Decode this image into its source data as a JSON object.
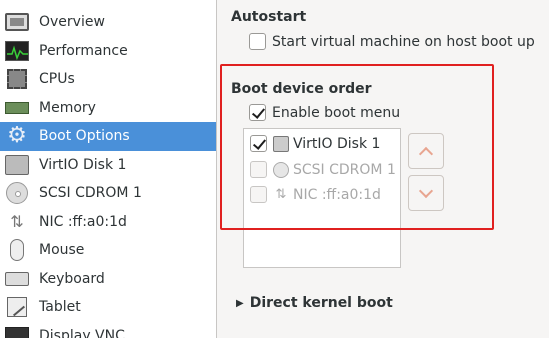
{
  "sidebar": {
    "items": [
      {
        "label": "Overview",
        "icon": "overview-icon"
      },
      {
        "label": "Performance",
        "icon": "performance-icon"
      },
      {
        "label": "CPUs",
        "icon": "cpu-icon"
      },
      {
        "label": "Memory",
        "icon": "memory-icon"
      },
      {
        "label": "Boot Options",
        "icon": "gear-icon",
        "selected": true
      },
      {
        "label": "VirtIO Disk 1",
        "icon": "disk-icon"
      },
      {
        "label": "SCSI CDROM 1",
        "icon": "cdrom-icon"
      },
      {
        "label": "NIC :ff:a0:1d",
        "icon": "network-icon"
      },
      {
        "label": "Mouse",
        "icon": "mouse-icon"
      },
      {
        "label": "Keyboard",
        "icon": "keyboard-icon"
      },
      {
        "label": "Tablet",
        "icon": "tablet-icon"
      },
      {
        "label": "Display VNC",
        "icon": "display-icon"
      }
    ]
  },
  "autostart": {
    "heading": "Autostart",
    "checkbox_label": "Start virtual machine on host boot up",
    "checked": false
  },
  "boot": {
    "heading": "Boot device order",
    "enable_menu_label": "Enable boot menu",
    "enable_menu_checked": true,
    "devices": [
      {
        "label": "VirtIO Disk 1",
        "checked": true,
        "enabled": true
      },
      {
        "label": "SCSI CDROM 1",
        "checked": false,
        "enabled": false
      },
      {
        "label": "NIC :ff:a0:1d",
        "checked": false,
        "enabled": false
      }
    ],
    "move_up_icon": "chevron-up-icon",
    "move_down_icon": "chevron-down-icon"
  },
  "kernel": {
    "expander_label": "Direct kernel boot",
    "expanded": false
  },
  "colors": {
    "selection": "#4a90d9",
    "highlight_box": "#e0201f",
    "arrow_chevron": "#e8a590"
  }
}
